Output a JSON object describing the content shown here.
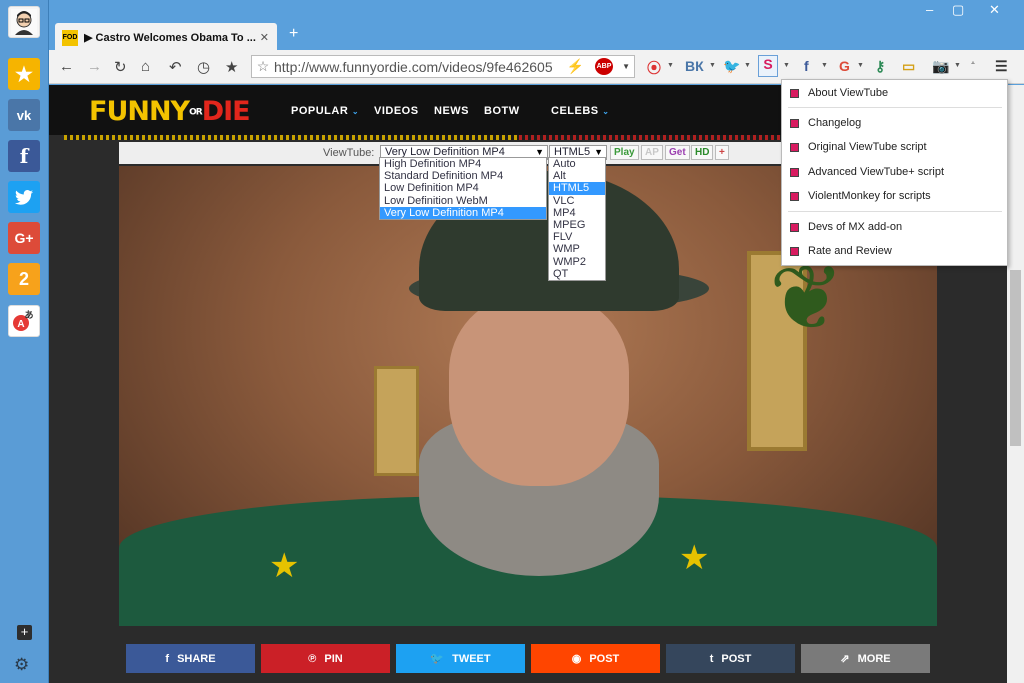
{
  "tab": {
    "favicon": "FOD",
    "title": "▶ Castro Welcomes Obama To ...",
    "close": "✕"
  },
  "new_tab": "+",
  "window_controls": {
    "minimize": "–",
    "maximize": "▢",
    "close": "✕"
  },
  "nav": {
    "back": "←",
    "forward": "→",
    "reload": "↻",
    "home": "⌂",
    "undo": "↶",
    "history": "◷",
    "bookmarks": "★"
  },
  "address": {
    "url": "http://www.funnyordie.com/videos/9fe462605",
    "abp": "ABP"
  },
  "extensions": {
    "vk": "ВК",
    "facebook": "f",
    "google": "G",
    "viewtube": "S"
  },
  "sidebar": {
    "fav": "★",
    "vk": "vk",
    "fb": "f",
    "twitter": "🐦",
    "gplus": "G+",
    "two": "2",
    "translate": "A",
    "add": "+",
    "settings": "⚙"
  },
  "site": {
    "logo": {
      "funny": "FUNNY",
      "or": "OR",
      "die": "DIE"
    },
    "nav": [
      {
        "label": "POPULAR",
        "caret": "⌄"
      },
      {
        "label": "VIDEOS"
      },
      {
        "label": "NEWS"
      },
      {
        "label": "BOTW"
      },
      {
        "label": "CELEBS",
        "caret": "⌄"
      }
    ]
  },
  "viewtube_bar": {
    "label": "ViewTube:",
    "quality_selected": "Very Low Definition MP4",
    "quality_options": [
      "High Definition MP4",
      "Standard Definition MP4",
      "Low Definition MP4",
      "Low Definition WebM",
      "Very Low Definition MP4"
    ],
    "player_selected": "HTML5",
    "player_options": [
      "Auto",
      "Alt",
      "HTML5",
      "VLC",
      "MP4",
      "MPEG",
      "FLV",
      "WMP",
      "WMP2",
      "QT"
    ],
    "buttons": {
      "play": "Play",
      "ap": "AP",
      "get": "Get",
      "hd": "HD",
      "plus": "+"
    }
  },
  "share_buttons": [
    {
      "icon": "f",
      "label": "SHARE",
      "color": "#3b5998"
    },
    {
      "icon": "℗",
      "label": "PIN",
      "color": "#cb2027"
    },
    {
      "icon": "🐦",
      "label": "TWEET",
      "color": "#1da1f2"
    },
    {
      "icon": "◉",
      "label": "POST",
      "color": "#ff4500"
    },
    {
      "icon": "t",
      "label": "POST",
      "color": "#35465c"
    },
    {
      "icon": "⇗",
      "label": "MORE",
      "color": "#7a7a7a"
    }
  ],
  "viewtube_menu": {
    "items": [
      "About ViewTube",
      "Changelog",
      "Original ViewTube script",
      "Advanced ViewTube+ script",
      "ViolentMonkey for scripts",
      "Devs of MX add-on",
      "Rate and Review"
    ]
  }
}
